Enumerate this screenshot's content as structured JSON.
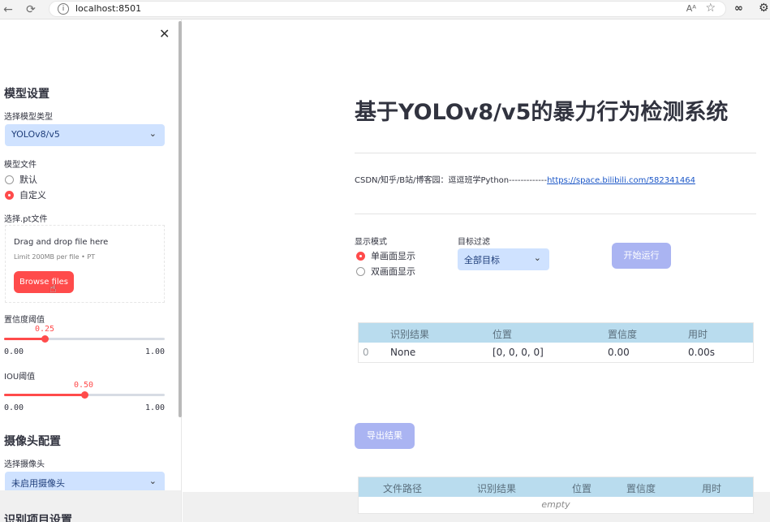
{
  "browser": {
    "url": "localhost:8501",
    "reader_label": "Aᴬ"
  },
  "sidebar": {
    "model_settings_heading": "模型设置",
    "model_type_label": "选择模型类型",
    "model_type_value": "YOLOv8/v5",
    "model_file_label": "模型文件",
    "model_file_options": [
      "默认",
      "自定义"
    ],
    "model_file_selected": "自定义",
    "pt_file_label": "选择.pt文件",
    "uploader": {
      "title": "Drag and drop file here",
      "limit": "Limit 200MB per file • PT",
      "button": "Browse files"
    },
    "confidence": {
      "label": "置信度阈值",
      "value": "0.25",
      "min": "0.00",
      "max": "1.00",
      "fraction": 0.25
    },
    "iou": {
      "label": "IOU阈值",
      "value": "0.50",
      "min": "0.00",
      "max": "1.00",
      "fraction": 0.5
    },
    "camera_heading": "摄像头配置",
    "camera_label": "选择摄像头",
    "camera_value": "未启用摄像头",
    "recognition_heading": "识别项目设置"
  },
  "main": {
    "title": "基于YOLOv8/v5的暴力行为检测系统",
    "link_prefix": "CSDN/知乎/B站/博客园：逗逗班学Python-------------",
    "link_text": "https://space.bilibili.com/582341464",
    "display_mode_label": "显示模式",
    "display_mode_options": [
      "单画面显示",
      "双画面显示"
    ],
    "display_mode_selected": "单画面显示",
    "target_filter_label": "目标过滤",
    "target_filter_value": "全部目标",
    "run_button": "开始运行",
    "export_button": "导出结果",
    "results_table": {
      "columns": [
        "识别结果",
        "位置",
        "置信度",
        "用时"
      ],
      "rows": [
        {
          "index": "0",
          "result": "None",
          "position": "[0, 0, 0, 0]",
          "confidence": "0.00",
          "time": "0.00s"
        }
      ]
    },
    "files_table": {
      "columns": [
        "文件路径",
        "识别结果",
        "位置",
        "置信度",
        "用时"
      ],
      "empty_text": "empty"
    }
  },
  "colors": {
    "accent": "#ff4b4b",
    "select_bg": "#cfe2ff",
    "button_disabled": "#aab4f2",
    "table_header": "#b9dcee"
  }
}
